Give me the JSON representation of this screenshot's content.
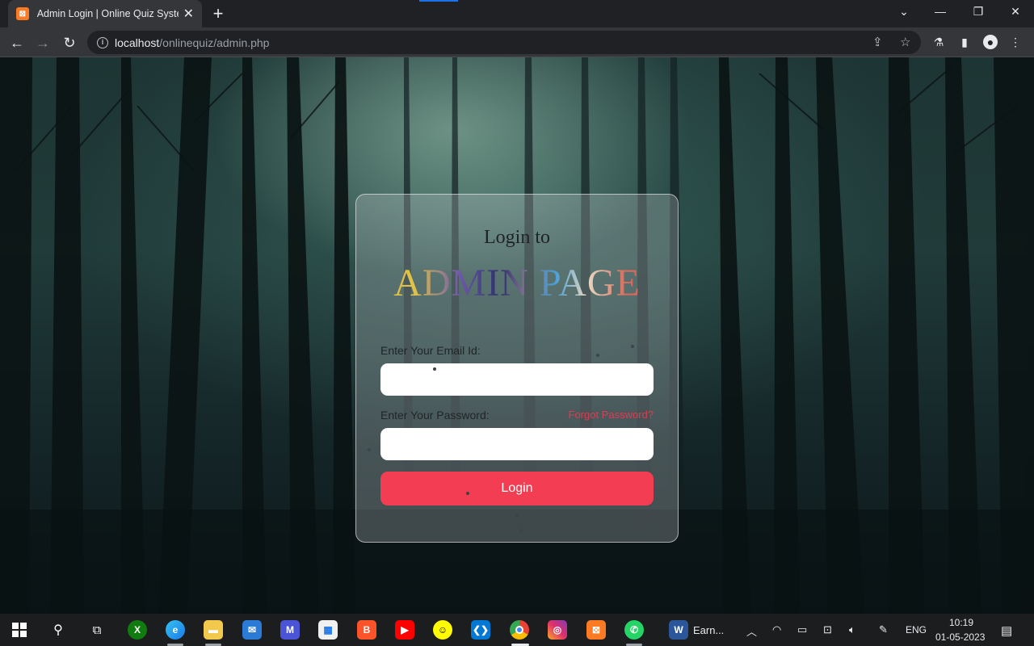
{
  "browser": {
    "tab_title": "Admin Login | Online Quiz System",
    "tab_favicon_glyph": "⊠",
    "url_host": "localhost",
    "url_path": "/onlinequiz/admin.php",
    "new_tab_glyph": "+",
    "tab_close_glyph": "✕"
  },
  "login": {
    "heading": "Login to",
    "title": "ADMIN PAGE",
    "email_label": "Enter Your Email Id:",
    "email_value": "",
    "password_label": "Enter Your Password:",
    "password_value": "",
    "forgot_label": "Forgot Password?",
    "login_button": "Login"
  },
  "colors": {
    "login_button": "#f33d52",
    "forgot_link": "#e03a52",
    "chrome_dark": "#202124"
  },
  "taskbar": {
    "pinned_icons": [
      "windows-start-icon",
      "search-icon",
      "task-view-icon",
      "xbox-icon",
      "edge-icon",
      "file-explorer-icon",
      "mail-icon",
      "zoom-mail-icon",
      "microsoft-store-icon",
      "brave-icon",
      "youtube-icon",
      "snapchat-icon",
      "vscode-icon",
      "chrome-icon",
      "instagram-icon",
      "xampp-icon",
      "whatsapp-icon",
      "word-icon"
    ],
    "word_label": "Earn...",
    "language": "ENG",
    "time": "10:19",
    "date": "01-05-2023"
  }
}
